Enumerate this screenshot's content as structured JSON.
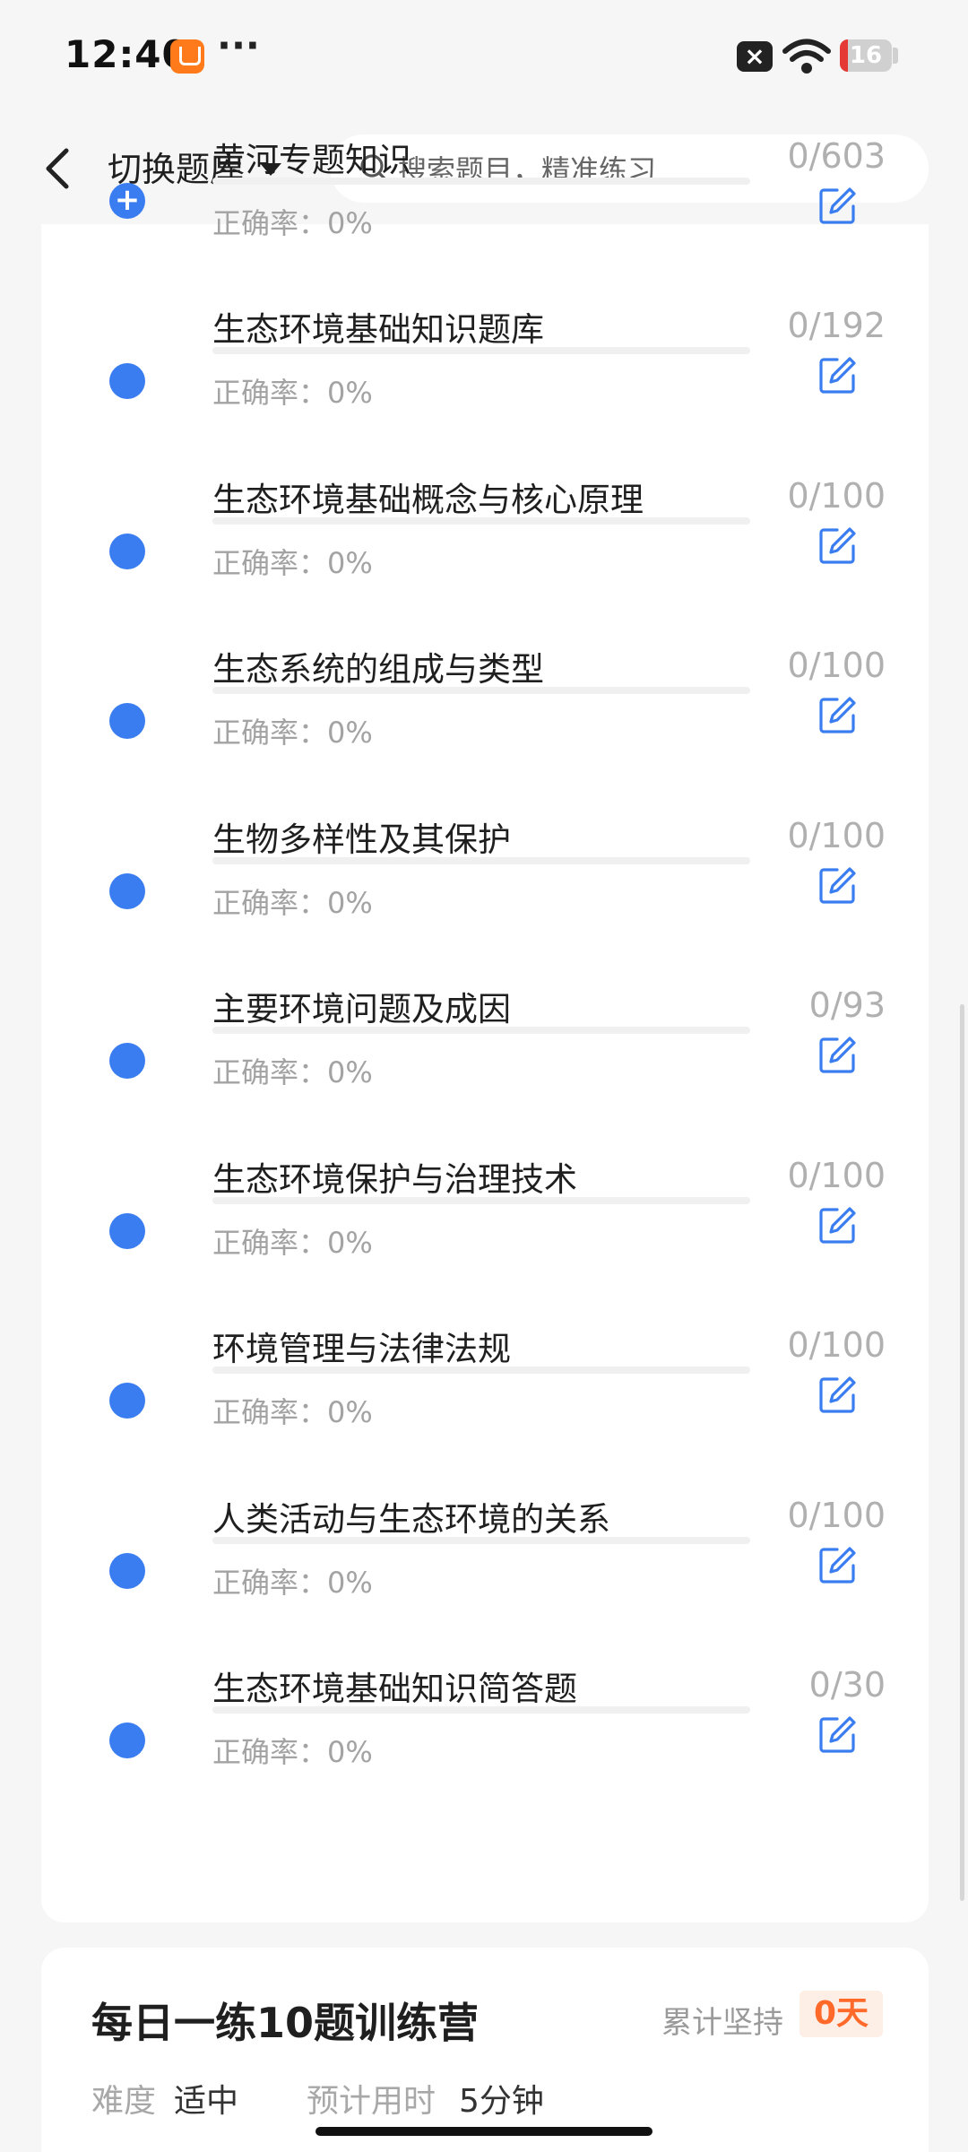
{
  "status_bar": {
    "time": "12:40",
    "more": "···",
    "battery": "16",
    "battery_level": 0.16
  },
  "header": {
    "switch_label": "切换题库",
    "search_placeholder": "搜索题目，精准练习"
  },
  "accuracy_prefix": "正确率：",
  "bank_items": [
    {
      "title": "黄河专题知识",
      "count": "0/603",
      "accuracy": "0%",
      "marker": "plus"
    },
    {
      "title": "生态环境基础知识题库",
      "count": "0/192",
      "accuracy": "0%"
    },
    {
      "title": "生态环境基础概念与核心原理",
      "count": "0/100",
      "accuracy": "0%"
    },
    {
      "title": "生态系统的组成与类型",
      "count": "0/100",
      "accuracy": "0%"
    },
    {
      "title": "生物多样性及其保护",
      "count": "0/100",
      "accuracy": "0%"
    },
    {
      "title": "主要环境问题及成因",
      "count": "0/93",
      "accuracy": "0%"
    },
    {
      "title": "生态环境保护与治理技术",
      "count": "0/100",
      "accuracy": "0%"
    },
    {
      "title": "环境管理与法律法规",
      "count": "0/100",
      "accuracy": "0%"
    },
    {
      "title": "人类活动与生态环境的关系",
      "count": "0/100",
      "accuracy": "0%"
    },
    {
      "title": "生态环境基础知识简答题",
      "count": "0/30",
      "accuracy": "0%"
    }
  ],
  "training": {
    "title": "每日一练10题训练营",
    "persist_label": "累计坚持",
    "persist_value": "0天",
    "difficulty_label": "难度",
    "difficulty_value": "适中",
    "time_label": "预计用时",
    "time_value": "5分钟"
  },
  "colors": {
    "accent": "#3a7df0",
    "muted_text": "#a3a3a3",
    "badge_bg": "#fdeee6",
    "badge_text": "#ff6a2b"
  }
}
